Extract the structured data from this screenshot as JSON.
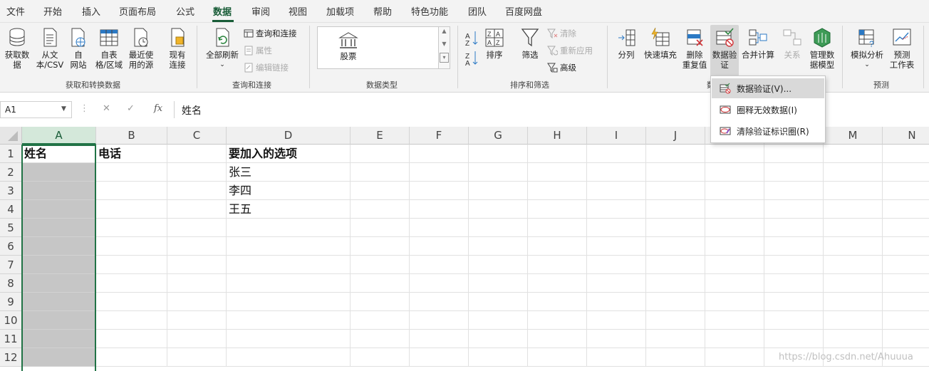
{
  "menu": {
    "items": [
      "文件",
      "开始",
      "插入",
      "页面布局",
      "公式",
      "数据",
      "审阅",
      "视图",
      "加载项",
      "帮助",
      "特色功能",
      "团队",
      "百度网盘"
    ],
    "active": "数据"
  },
  "ribbon": {
    "get_data": {
      "group_label": "获取和转换数据",
      "get_data": "获取数\n据",
      "from_text": "从文\n本/CSV",
      "from_web": "自\n网站",
      "from_table": "自表\n格/区域",
      "recent_sources": "最近使\n用的源",
      "existing_connections": "现有\n连接"
    },
    "queries": {
      "group_label": "查询和连接",
      "refresh_all": "全部刷新",
      "queries_connections": "查询和连接",
      "properties": "属性",
      "edit_links": "编辑链接"
    },
    "data_types": {
      "group_label": "数据类型",
      "stock": "股票"
    },
    "sort_filter": {
      "group_label": "排序和筛选",
      "sort": "排序",
      "filter": "筛选",
      "clear": "清除",
      "reapply": "重新应用",
      "advanced": "高级"
    },
    "data_tools": {
      "group_label": "数",
      "text_to_columns": "分列",
      "flash_fill": "快速填充",
      "remove_duplicates": "删除\n重复值",
      "data_validation": "数据验\n证",
      "consolidate": "合并计算",
      "relationships": "关系",
      "manage_data_model": "管理数\n据模型"
    },
    "forecast": {
      "group_label": "预测",
      "what_if": "模拟分析",
      "forecast_sheet": "预测\n工作表"
    }
  },
  "dropdown": {
    "items": [
      {
        "label": "数据验证(V)..."
      },
      {
        "label": "圈释无效数据(I)"
      },
      {
        "label": "清除验证标识圈(R)"
      }
    ]
  },
  "formula_bar": {
    "name_box": "A1",
    "cancel": "✕",
    "enter": "✓",
    "fx": "fx",
    "content": "姓名"
  },
  "sheet": {
    "columns": [
      "A",
      "B",
      "C",
      "D",
      "E",
      "F",
      "G",
      "H",
      "I",
      "J",
      "K",
      "L",
      "M",
      "N"
    ],
    "rows": [
      "1",
      "2",
      "3",
      "4",
      "5",
      "6",
      "7",
      "8",
      "9",
      "10",
      "11",
      "12"
    ],
    "cells": {
      "A1": "姓名",
      "B1": "电话",
      "D1": "要加入的选项",
      "D2": "张三",
      "D3": "李四",
      "D4": "王五"
    }
  },
  "watermark": "https://blog.csdn.net/Ahuuua",
  "colors": {
    "accent": "#217346",
    "accent_dark": "#185c37"
  }
}
